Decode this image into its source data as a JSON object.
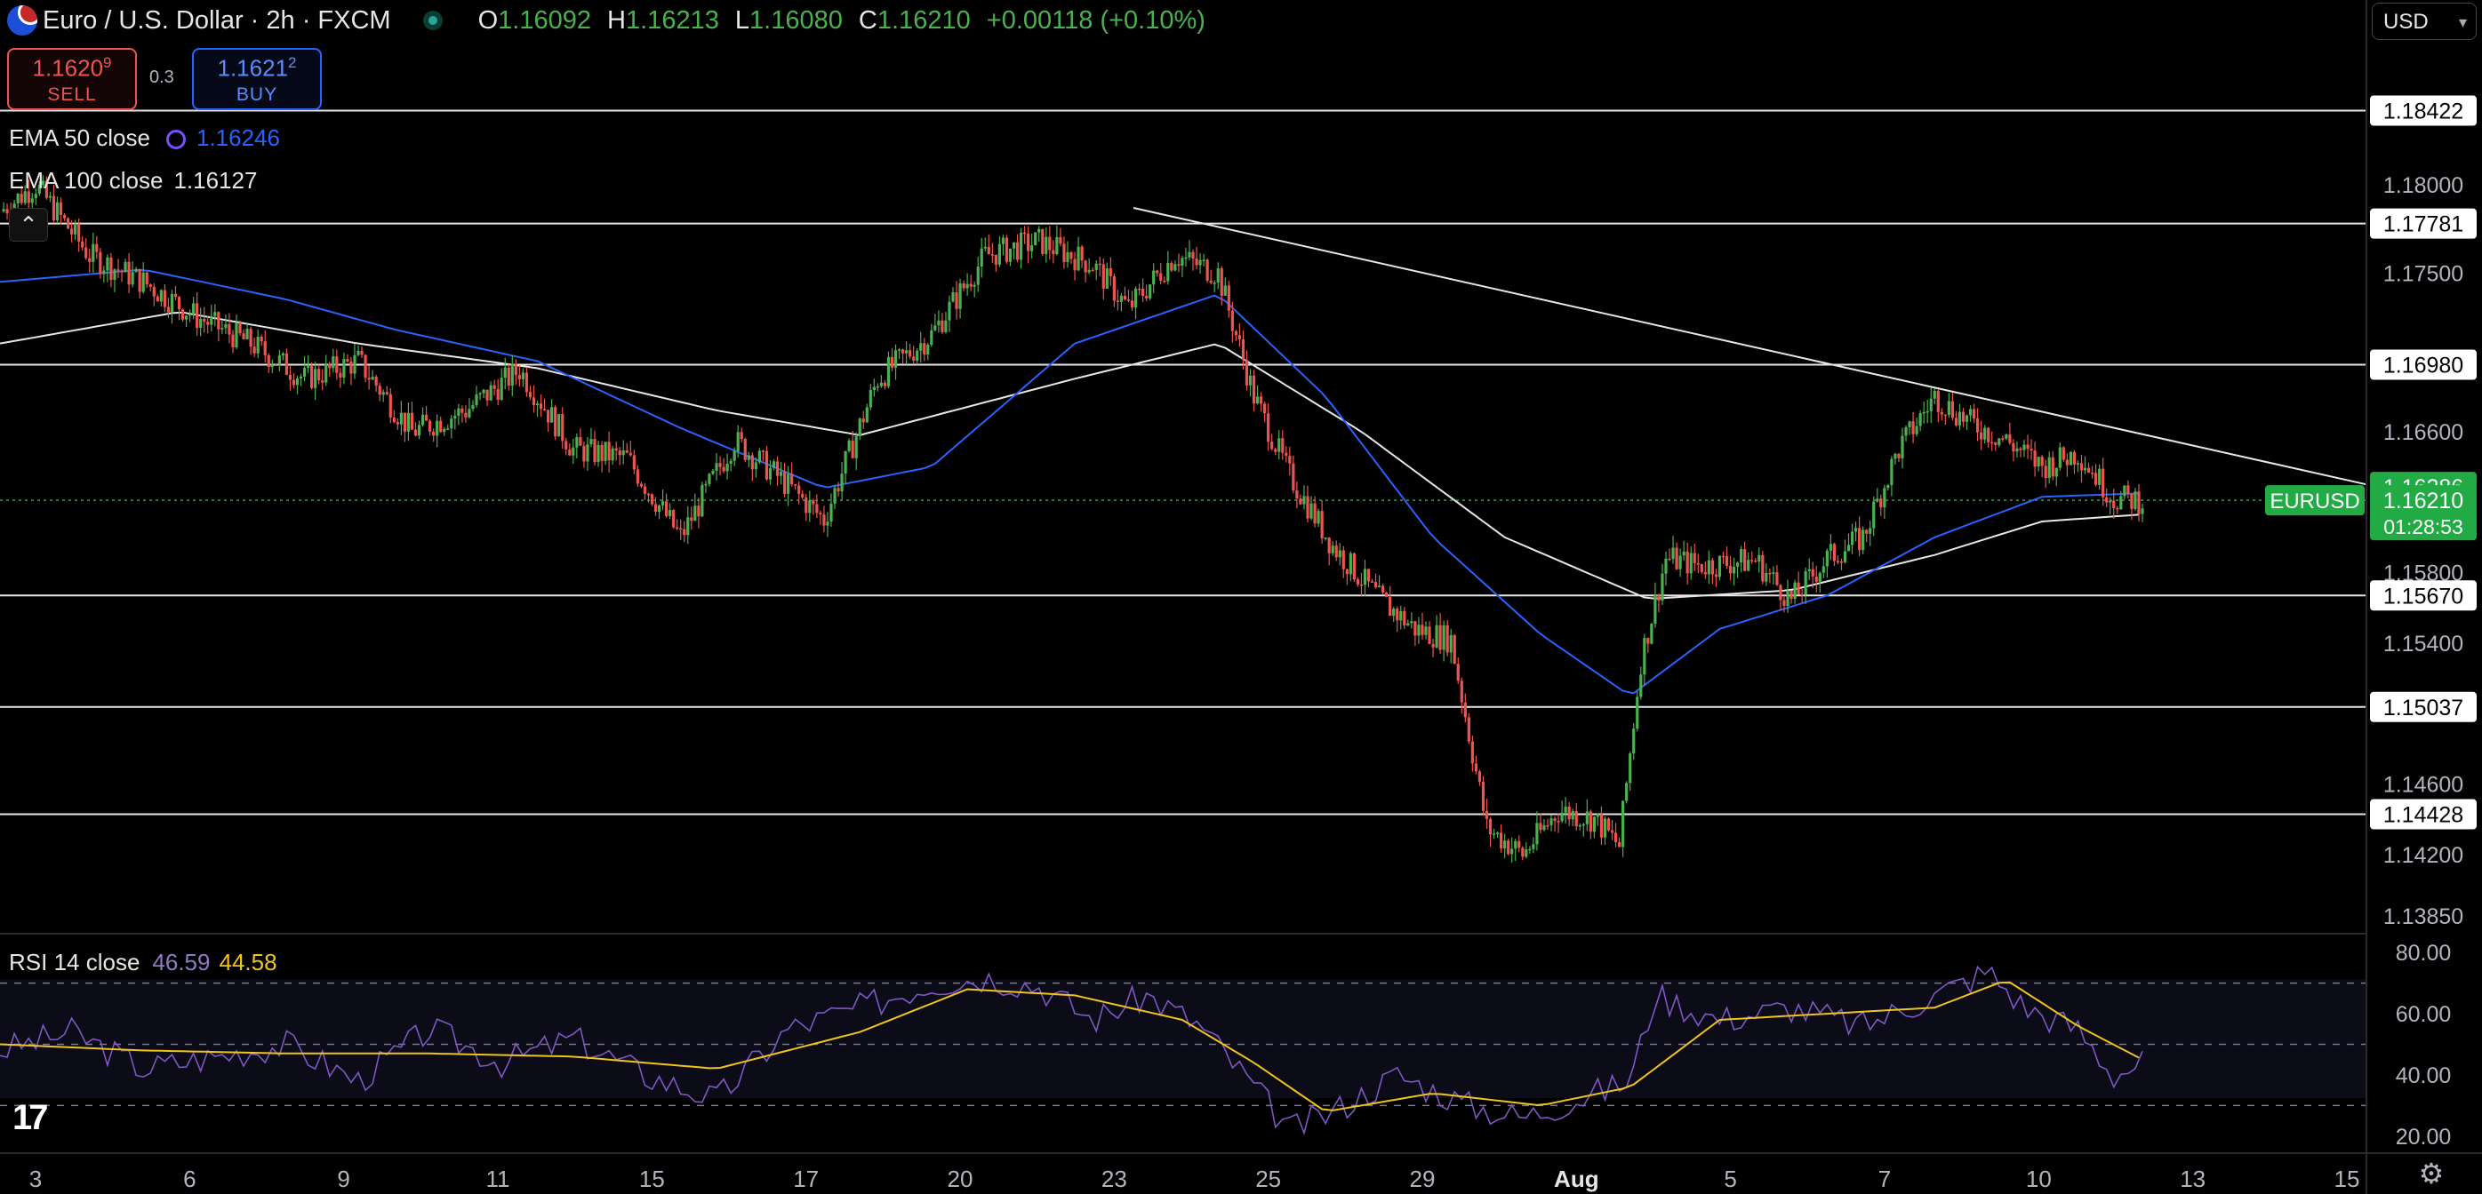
{
  "header": {
    "symbol_title": "Euro / U.S. Dollar · 2h · FXCM",
    "ohlc": {
      "o_label": "O",
      "o": "1.16092",
      "h_label": "H",
      "h": "1.16213",
      "l_label": "L",
      "l": "1.16080",
      "c_label": "C",
      "c": "1.16210",
      "change": "+0.00118 (+0.10%)"
    }
  },
  "trade": {
    "sell_price_main": "1.1620",
    "sell_price_sup": "9",
    "sell_label": "SELL",
    "spread": "0.3",
    "buy_price_main": "1.1621",
    "buy_price_sup": "2",
    "buy_label": "BUY"
  },
  "indicators": {
    "ema50_label": "EMA 50 close",
    "ema50_value": "1.16246",
    "ema100_label": "EMA 100 close",
    "ema100_value": "1.16127",
    "rsi_label": "RSI 14 close",
    "rsi_value": "46.59",
    "rsi_ma_value": "44.58"
  },
  "currency_select": "USD",
  "colors": {
    "up": "#4caf50",
    "down": "#ef5350",
    "ema50": "#2962ff",
    "ema100": "#e6e6e6",
    "rsi": "#7e57c2",
    "rsi_ma": "#f0c419",
    "last_price_badge": "#22ab45"
  },
  "icons": [
    "flag-icon",
    "market-status-icon",
    "indicator-settings-icon",
    "collapse-icon",
    "tradingview-logo-icon",
    "settings-gear-icon",
    "chevron-down-icon"
  ],
  "chart_data": {
    "type": "candlestick",
    "symbol": "EURUSD",
    "timeframe": "2h",
    "ylim": [
      1.1375,
      1.1905
    ],
    "price_ticks": [
      "1.18000",
      "1.17500",
      "1.16600",
      "1.15800",
      "1.15400",
      "1.14600",
      "1.14200",
      "1.13850"
    ],
    "x_ticks": [
      "3",
      "6",
      "9",
      "11",
      "15",
      "17",
      "20",
      "23",
      "25",
      "29",
      "Aug",
      "5",
      "7",
      "10",
      "13",
      "15"
    ],
    "horizontal_levels": [
      1.18422,
      1.17781,
      1.1698,
      1.1567,
      1.15037,
      1.14428
    ],
    "trendline": [
      {
        "x": "Jul 24",
        "y": 1.1787
      },
      {
        "x": "Aug 14",
        "y": 1.163
      }
    ],
    "last_price": {
      "label": "EURUSD",
      "value": "1.16210",
      "countdown": "01:28:53"
    },
    "ema50_last": "1.16286",
    "close_path": [
      [
        0,
        1.1785
      ],
      [
        10,
        1.18
      ],
      [
        25,
        1.176
      ],
      [
        40,
        1.1745
      ],
      [
        55,
        1.1725
      ],
      [
        70,
        1.171
      ],
      [
        85,
        1.169
      ],
      [
        100,
        1.17
      ],
      [
        115,
        1.166
      ],
      [
        130,
        1.1672
      ],
      [
        145,
        1.1695
      ],
      [
        160,
        1.165
      ],
      [
        175,
        1.1645
      ],
      [
        190,
        1.16
      ],
      [
        205,
        1.1655
      ],
      [
        218,
        1.1633
      ],
      [
        230,
        1.161
      ],
      [
        245,
        1.169
      ],
      [
        260,
        1.1715
      ],
      [
        275,
        1.176
      ],
      [
        290,
        1.1768
      ],
      [
        305,
        1.1755
      ],
      [
        315,
        1.173
      ],
      [
        328,
        1.176
      ],
      [
        340,
        1.175
      ],
      [
        350,
        1.168
      ],
      [
        360,
        1.1635
      ],
      [
        372,
        1.1595
      ],
      [
        385,
        1.1565
      ],
      [
        395,
        1.1548
      ],
      [
        405,
        1.1542
      ],
      [
        415,
        1.1435
      ],
      [
        425,
        1.142
      ],
      [
        435,
        1.1445
      ],
      [
        445,
        1.144
      ],
      [
        452,
        1.1425
      ],
      [
        458,
        1.153
      ],
      [
        465,
        1.1588
      ],
      [
        475,
        1.1584
      ],
      [
        490,
        1.1587
      ],
      [
        500,
        1.1564
      ],
      [
        510,
        1.1588
      ],
      [
        520,
        1.16
      ],
      [
        530,
        1.165
      ],
      [
        540,
        1.168
      ],
      [
        550,
        1.1665
      ],
      [
        560,
        1.1655
      ],
      [
        570,
        1.164
      ],
      [
        580,
        1.1648
      ],
      [
        590,
        1.1622
      ],
      [
        598,
        1.1621
      ]
    ],
    "ema50_path": [
      [
        0,
        1.1745
      ],
      [
        40,
        1.1752
      ],
      [
        80,
        1.1735
      ],
      [
        110,
        1.1718
      ],
      [
        150,
        1.17
      ],
      [
        190,
        1.1662
      ],
      [
        230,
        1.1628
      ],
      [
        260,
        1.164
      ],
      [
        300,
        1.171
      ],
      [
        340,
        1.1738
      ],
      [
        370,
        1.168
      ],
      [
        400,
        1.16
      ],
      [
        430,
        1.1545
      ],
      [
        455,
        1.151
      ],
      [
        480,
        1.1548
      ],
      [
        510,
        1.1567
      ],
      [
        540,
        1.16
      ],
      [
        570,
        1.1623
      ],
      [
        598,
        1.1625
      ]
    ],
    "ema100_path": [
      [
        0,
        1.171
      ],
      [
        50,
        1.1728
      ],
      [
        100,
        1.171
      ],
      [
        150,
        1.1696
      ],
      [
        200,
        1.1672
      ],
      [
        240,
        1.1658
      ],
      [
        300,
        1.169
      ],
      [
        340,
        1.171
      ],
      [
        380,
        1.166
      ],
      [
        420,
        1.16
      ],
      [
        460,
        1.1565
      ],
      [
        500,
        1.157
      ],
      [
        540,
        1.159
      ],
      [
        570,
        1.1609
      ],
      [
        598,
        1.1613
      ]
    ],
    "rsi": {
      "ylim": [
        15,
        85
      ],
      "ticks": [
        "80.00",
        "60.00",
        "40.00",
        "20.00"
      ],
      "bands": [
        70,
        50,
        30
      ],
      "line": [
        [
          0,
          48
        ],
        [
          20,
          54
        ],
        [
          40,
          42
        ],
        [
          60,
          46
        ],
        [
          80,
          50
        ],
        [
          100,
          38
        ],
        [
          120,
          55
        ],
        [
          140,
          44
        ],
        [
          160,
          52
        ],
        [
          180,
          40
        ],
        [
          200,
          32
        ],
        [
          220,
          55
        ],
        [
          240,
          62
        ],
        [
          260,
          70
        ],
        [
          275,
          72
        ],
        [
          290,
          69
        ],
        [
          305,
          58
        ],
        [
          320,
          66
        ],
        [
          335,
          56
        ],
        [
          350,
          36
        ],
        [
          360,
          22
        ],
        [
          372,
          28
        ],
        [
          390,
          40
        ],
        [
          410,
          30
        ],
        [
          425,
          26
        ],
        [
          440,
          32
        ],
        [
          455,
          38
        ],
        [
          462,
          66
        ],
        [
          480,
          58
        ],
        [
          500,
          62
        ],
        [
          520,
          56
        ],
        [
          540,
          66
        ],
        [
          555,
          74
        ],
        [
          565,
          62
        ],
        [
          580,
          55
        ],
        [
          590,
          40
        ],
        [
          598,
          44
        ]
      ],
      "ma": [
        [
          0,
          50
        ],
        [
          40,
          48
        ],
        [
          80,
          47
        ],
        [
          120,
          47
        ],
        [
          160,
          46
        ],
        [
          200,
          42
        ],
        [
          240,
          54
        ],
        [
          270,
          68
        ],
        [
          300,
          66
        ],
        [
          330,
          58
        ],
        [
          350,
          44
        ],
        [
          370,
          28
        ],
        [
          400,
          34
        ],
        [
          430,
          30
        ],
        [
          455,
          36
        ],
        [
          480,
          58
        ],
        [
          510,
          60
        ],
        [
          540,
          62
        ],
        [
          560,
          71
        ],
        [
          580,
          56
        ],
        [
          598,
          45
        ]
      ]
    }
  }
}
